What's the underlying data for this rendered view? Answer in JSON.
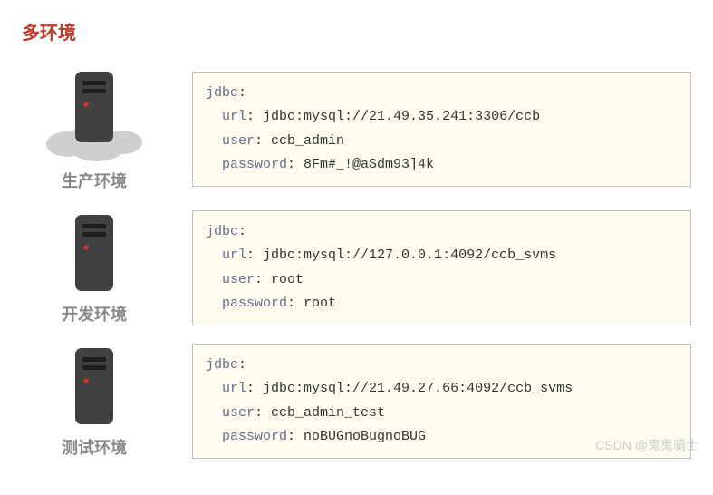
{
  "title": "多环境",
  "environments": [
    {
      "label": "生产环境",
      "showCloud": true,
      "jdbc": {
        "header": "jdbc",
        "url_key": "url",
        "url_val": "jdbc:mysql://21.49.35.241:3306/ccb",
        "user_key": "user",
        "user_val": "ccb_admin",
        "password_key": "password",
        "password_val": "8Fm#_!@aSdm93]4k"
      }
    },
    {
      "label": "开发环境",
      "showCloud": false,
      "jdbc": {
        "header": "jdbc",
        "url_key": "url",
        "url_val": "jdbc:mysql://127.0.0.1:4092/ccb_svms",
        "user_key": "user",
        "user_val": "root",
        "password_key": "password",
        "password_val": "root"
      }
    },
    {
      "label": "测试环境",
      "showCloud": false,
      "jdbc": {
        "header": "jdbc",
        "url_key": "url",
        "url_val": "jdbc:mysql://21.49.27.66:4092/ccb_svms",
        "user_key": "user",
        "user_val": "ccb_admin_test",
        "password_key": "password",
        "password_val": "noBUGnoBugnoBUG"
      }
    }
  ],
  "watermark": "CSDN @鬼鬼骑士"
}
